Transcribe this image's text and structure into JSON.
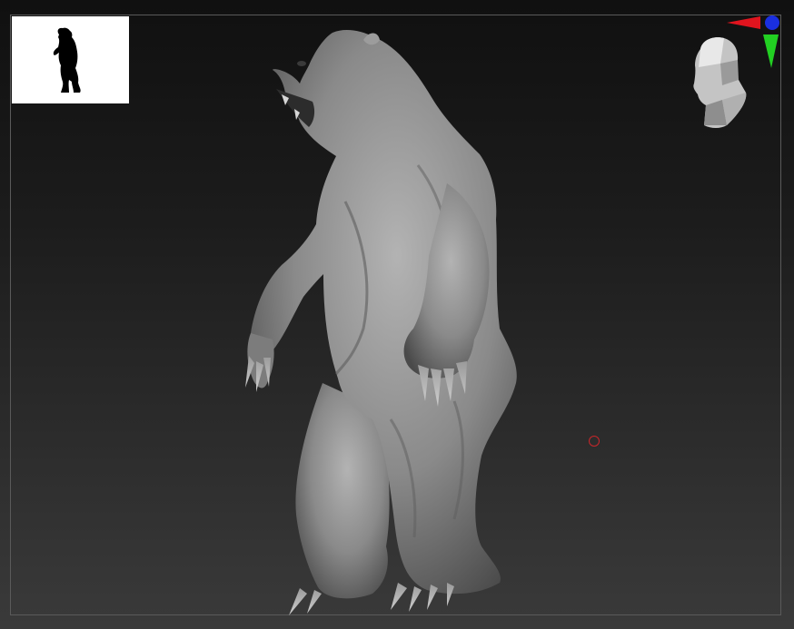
{
  "viewport": {
    "background_top": "#101010",
    "background_bottom": "#3a3a3a",
    "frame_color": "#5a5a5a"
  },
  "navigator": {
    "background": "#ffffff",
    "silhouette_color": "#000000",
    "icon": "bear-silhouette-icon"
  },
  "gizmo": {
    "x_axis_color": "#e0141e",
    "y_axis_color": "#22d022",
    "z_axis_color": "#1a2fe0",
    "head_icon": "orientation-head-icon"
  },
  "model": {
    "icon": "bear-sculpt-icon",
    "clay_color": "#8a8a8a"
  },
  "cursor": {
    "icon": "brush-cursor-icon",
    "color": "#c8262a"
  }
}
